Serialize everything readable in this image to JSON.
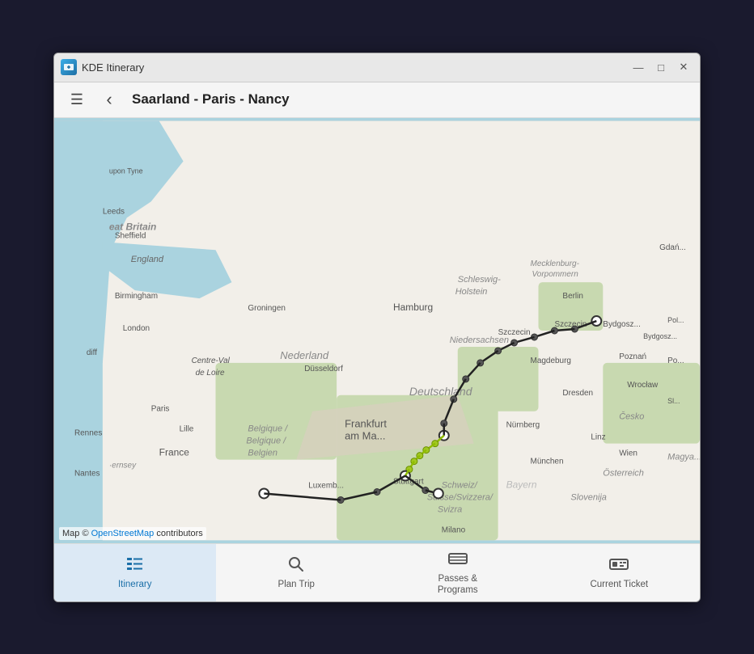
{
  "window": {
    "title": "KDE Itinerary",
    "app_icon_alt": "kde-itinerary-icon",
    "controls": {
      "minimize": "—",
      "maximize": "□",
      "close": "✕"
    }
  },
  "toolbar": {
    "menu_label": "☰",
    "back_label": "‹",
    "title": "Saarland - Paris - Nancy"
  },
  "map": {
    "attribution_prefix": "Map © ",
    "attribution_link_text": "OpenStreetMap",
    "attribution_suffix": " contributors"
  },
  "bottom_nav": {
    "items": [
      {
        "id": "itinerary",
        "label": "Itinerary",
        "icon": "itinerary-icon",
        "active": true
      },
      {
        "id": "plan-trip",
        "label": "Plan Trip",
        "icon": "search-icon",
        "active": false
      },
      {
        "id": "passes-programs",
        "label": "Passes &\nPrograms",
        "icon": "passes-icon",
        "active": false
      },
      {
        "id": "current-ticket",
        "label": "Current Ticket",
        "icon": "ticket-icon",
        "active": false
      }
    ]
  }
}
